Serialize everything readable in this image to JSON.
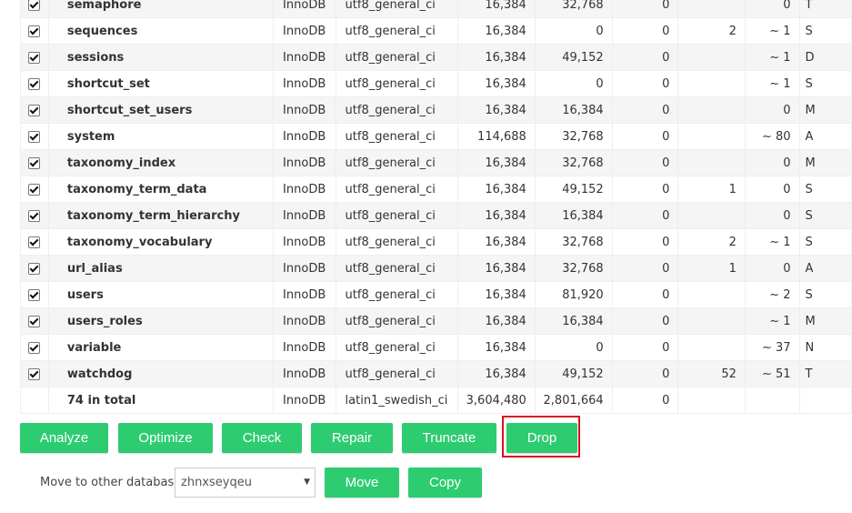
{
  "table_rows": [
    {
      "name": "semaphore",
      "engine": "InnoDB",
      "collation": "utf8_general_ci",
      "data_length": "16,384",
      "index_length": "32,768",
      "data_free": "0",
      "auto_increment": "",
      "rows": "0",
      "comment": "T"
    },
    {
      "name": "sequences",
      "engine": "InnoDB",
      "collation": "utf8_general_ci",
      "data_length": "16,384",
      "index_length": "0",
      "data_free": "0",
      "auto_increment": "2",
      "rows": "~ 1",
      "comment": "S"
    },
    {
      "name": "sessions",
      "engine": "InnoDB",
      "collation": "utf8_general_ci",
      "data_length": "16,384",
      "index_length": "49,152",
      "data_free": "0",
      "auto_increment": "",
      "rows": "~ 1",
      "comment": "D"
    },
    {
      "name": "shortcut_set",
      "engine": "InnoDB",
      "collation": "utf8_general_ci",
      "data_length": "16,384",
      "index_length": "0",
      "data_free": "0",
      "auto_increment": "",
      "rows": "~ 1",
      "comment": "S"
    },
    {
      "name": "shortcut_set_users",
      "engine": "InnoDB",
      "collation": "utf8_general_ci",
      "data_length": "16,384",
      "index_length": "16,384",
      "data_free": "0",
      "auto_increment": "",
      "rows": "0",
      "comment": "M"
    },
    {
      "name": "system",
      "engine": "InnoDB",
      "collation": "utf8_general_ci",
      "data_length": "114,688",
      "index_length": "32,768",
      "data_free": "0",
      "auto_increment": "",
      "rows": "~ 80",
      "comment": "A"
    },
    {
      "name": "taxonomy_index",
      "engine": "InnoDB",
      "collation": "utf8_general_ci",
      "data_length": "16,384",
      "index_length": "32,768",
      "data_free": "0",
      "auto_increment": "",
      "rows": "0",
      "comment": "M"
    },
    {
      "name": "taxonomy_term_data",
      "engine": "InnoDB",
      "collation": "utf8_general_ci",
      "data_length": "16,384",
      "index_length": "49,152",
      "data_free": "0",
      "auto_increment": "1",
      "rows": "0",
      "comment": "S"
    },
    {
      "name": "taxonomy_term_hierarchy",
      "engine": "InnoDB",
      "collation": "utf8_general_ci",
      "data_length": "16,384",
      "index_length": "16,384",
      "data_free": "0",
      "auto_increment": "",
      "rows": "0",
      "comment": "S"
    },
    {
      "name": "taxonomy_vocabulary",
      "engine": "InnoDB",
      "collation": "utf8_general_ci",
      "data_length": "16,384",
      "index_length": "32,768",
      "data_free": "0",
      "auto_increment": "2",
      "rows": "~ 1",
      "comment": "S"
    },
    {
      "name": "url_alias",
      "engine": "InnoDB",
      "collation": "utf8_general_ci",
      "data_length": "16,384",
      "index_length": "32,768",
      "data_free": "0",
      "auto_increment": "1",
      "rows": "0",
      "comment": "A"
    },
    {
      "name": "users",
      "engine": "InnoDB",
      "collation": "utf8_general_ci",
      "data_length": "16,384",
      "index_length": "81,920",
      "data_free": "0",
      "auto_increment": "",
      "rows": "~ 2",
      "comment": "S"
    },
    {
      "name": "users_roles",
      "engine": "InnoDB",
      "collation": "utf8_general_ci",
      "data_length": "16,384",
      "index_length": "16,384",
      "data_free": "0",
      "auto_increment": "",
      "rows": "~ 1",
      "comment": "M"
    },
    {
      "name": "variable",
      "engine": "InnoDB",
      "collation": "utf8_general_ci",
      "data_length": "16,384",
      "index_length": "0",
      "data_free": "0",
      "auto_increment": "",
      "rows": "~ 37",
      "comment": "N"
    },
    {
      "name": "watchdog",
      "engine": "InnoDB",
      "collation": "utf8_general_ci",
      "data_length": "16,384",
      "index_length": "49,152",
      "data_free": "0",
      "auto_increment": "52",
      "rows": "~ 51",
      "comment": "T"
    }
  ],
  "summary": {
    "label": "74 in total",
    "engine": "InnoDB",
    "collation": "latin1_swedish_ci",
    "data_length": "3,604,480",
    "index_length": "2,801,664",
    "data_free": "0"
  },
  "actions": {
    "analyze": "Analyze",
    "optimize": "Optimize",
    "check": "Check",
    "repair": "Repair",
    "truncate": "Truncate",
    "drop": "Drop"
  },
  "move": {
    "label": "Move to other database:",
    "selected_db": "zhnxseyqeu",
    "move_button": "Move",
    "copy_button": "Copy"
  },
  "colors": {
    "button_green": "#2ecc71",
    "highlight_red": "#d7111e"
  }
}
